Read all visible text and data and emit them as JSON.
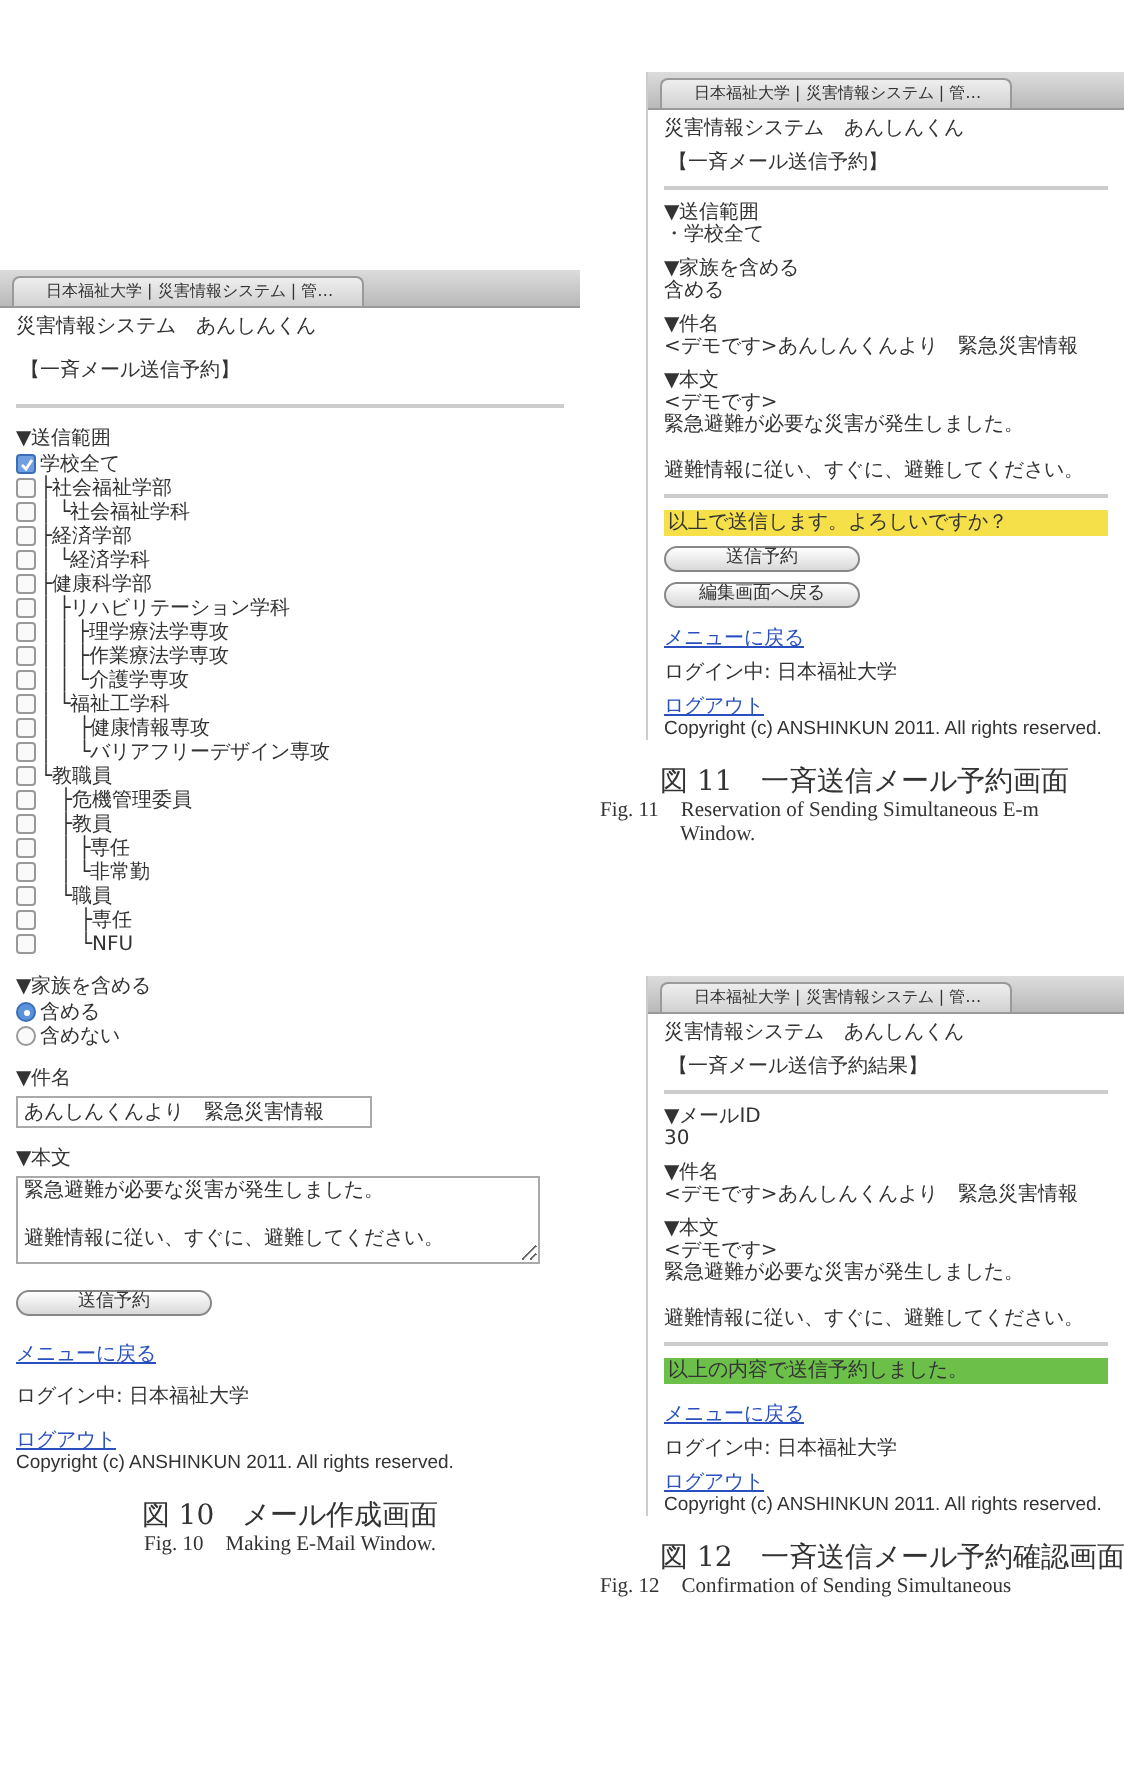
{
  "figures": [
    {
      "screen": {
        "tab_title": "日本福祉大学 | 災害情報システム | 管…",
        "site_title": "災害情報システム　あんしんくん",
        "page_heading": "【一斉メール送信予約】",
        "sections": [
          {
            "kind": "tree",
            "heading": "▼送信範囲",
            "items": [
              {
                "label": "学校全て",
                "checked": true,
                "children": [
                  {
                    "label": "├社会福祉学部",
                    "checked": false,
                    "children": [
                      {
                        "label": "│ └社会福祉学科",
                        "checked": false
                      }
                    ]
                  },
                  {
                    "label": "├経済学部",
                    "checked": false,
                    "children": [
                      {
                        "label": "│ └経済学科",
                        "checked": false
                      }
                    ]
                  },
                  {
                    "label": "├健康科学部",
                    "checked": false,
                    "children": [
                      {
                        "label": "│ ├リハビリテーション学科",
                        "checked": false,
                        "children": [
                          {
                            "label": "│ │ ├理学療法学専攻",
                            "checked": false
                          },
                          {
                            "label": "│ │ ├作業療法学専攻",
                            "checked": false
                          },
                          {
                            "label": "│ │ └介護学専攻",
                            "checked": false
                          }
                        ]
                      },
                      {
                        "label": "│ └福祉工学科",
                        "checked": false,
                        "children": [
                          {
                            "label": "│　 ├健康情報専攻",
                            "checked": false
                          },
                          {
                            "label": "│　 └バリアフリーデザイン専攻",
                            "checked": false
                          }
                        ]
                      }
                    ]
                  },
                  {
                    "label": "└教職員",
                    "checked": false,
                    "children": [
                      {
                        "label": "　├危機管理委員",
                        "checked": false
                      },
                      {
                        "label": "　├教員",
                        "checked": false,
                        "children": [
                          {
                            "label": "　│ ├専任",
                            "checked": false
                          },
                          {
                            "label": "　│ └非常勤",
                            "checked": false
                          }
                        ]
                      },
                      {
                        "label": "　└職員",
                        "checked": false,
                        "children": [
                          {
                            "label": "　　├専任",
                            "checked": false
                          },
                          {
                            "label": "　　└NFU",
                            "checked": false
                          }
                        ]
                      }
                    ]
                  }
                ]
              }
            ]
          },
          {
            "kind": "radio",
            "heading": "▼家族を含める",
            "options": [
              {
                "label": "含める",
                "selected": true
              },
              {
                "label": "含めない",
                "selected": false
              }
            ]
          },
          {
            "kind": "input",
            "heading": "▼件名",
            "value": "あんしんくんより　緊急災害情報"
          },
          {
            "kind": "textarea",
            "heading": "▼本文",
            "paragraphs": [
              "緊急避難が必要な災害が発生しました。",
              "避難情報に従い、すぐに、避難してください。"
            ]
          }
        ],
        "buttons": [
          "送信予約"
        ],
        "menu_link": "メニューに戻る",
        "login_status": "ログイン中: 日本福祉大学",
        "logout_link": "ログアウト",
        "copyright": "Copyright (c) ANSHINKUN 2011. All rights reserved."
      },
      "caption": "図 10　メール作成画面",
      "caption_en": [
        "Fig. 10　Making E-Mail Window."
      ]
    },
    {
      "screen": {
        "tab_title": "日本福祉大学 | 災害情報システム | 管…",
        "site_title": "災害情報システム　あんしんくん",
        "page_heading": "【一斉メール送信予約】",
        "sections": [
          {
            "kind": "text",
            "heading": "▼送信範囲",
            "paragraphs": [
              [
                "・学校全て"
              ]
            ]
          },
          {
            "kind": "text",
            "heading": "▼家族を含める",
            "paragraphs": [
              [
                "含める"
              ]
            ]
          },
          {
            "kind": "text",
            "heading": "▼件名",
            "paragraphs": [
              [
                "<デモです>あんしんくんより　緊急災害情報"
              ]
            ]
          },
          {
            "kind": "text",
            "heading": "▼本文",
            "paragraphs": [
              [
                "<デモです>",
                "緊急避難が必要な災害が発生しました。"
              ],
              [
                "避難情報に従い、すぐに、避難してください。"
              ]
            ]
          }
        ],
        "notice": {
          "kind": "warning",
          "text": "以上で送信します。よろしいですか？"
        },
        "buttons": [
          "送信予約",
          "編集画面へ戻る"
        ],
        "menu_link": "メニューに戻る",
        "login_status": "ログイン中: 日本福祉大学",
        "logout_link": "ログアウト",
        "copyright": "Copyright (c) ANSHINKUN 2011. All rights reserved."
      },
      "caption": "図 11　一斉送信メール予約画面",
      "caption_en": [
        "Fig. 11　Reservation of Sending Simultaneous E-m",
        "Window."
      ]
    },
    {
      "screen": {
        "tab_title": "日本福祉大学 | 災害情報システム | 管…",
        "site_title": "災害情報システム　あんしんくん",
        "page_heading": "【一斉メール送信予約結果】",
        "sections": [
          {
            "kind": "text",
            "heading": "▼メールID",
            "paragraphs": [
              [
                "30"
              ]
            ]
          },
          {
            "kind": "text",
            "heading": "▼件名",
            "paragraphs": [
              [
                "<デモです>あんしんくんより　緊急災害情報"
              ]
            ]
          },
          {
            "kind": "text",
            "heading": "▼本文",
            "paragraphs": [
              [
                "<デモです>",
                "緊急避難が必要な災害が発生しました。"
              ],
              [
                "避難情報に従い、すぐに、避難してください。"
              ]
            ]
          }
        ],
        "notice": {
          "kind": "success",
          "text": "以上の内容で送信予約しました。"
        },
        "menu_link": "メニューに戻る",
        "login_status": "ログイン中: 日本福祉大学",
        "logout_link": "ログアウト",
        "copyright": "Copyright (c) ANSHINKUN 2011. All rights reserved."
      },
      "caption": "図 12　一斉送信メール予約確認画面",
      "caption_en": [
        "Fig. 12　Confirmation of Sending Simultaneous"
      ]
    }
  ]
}
